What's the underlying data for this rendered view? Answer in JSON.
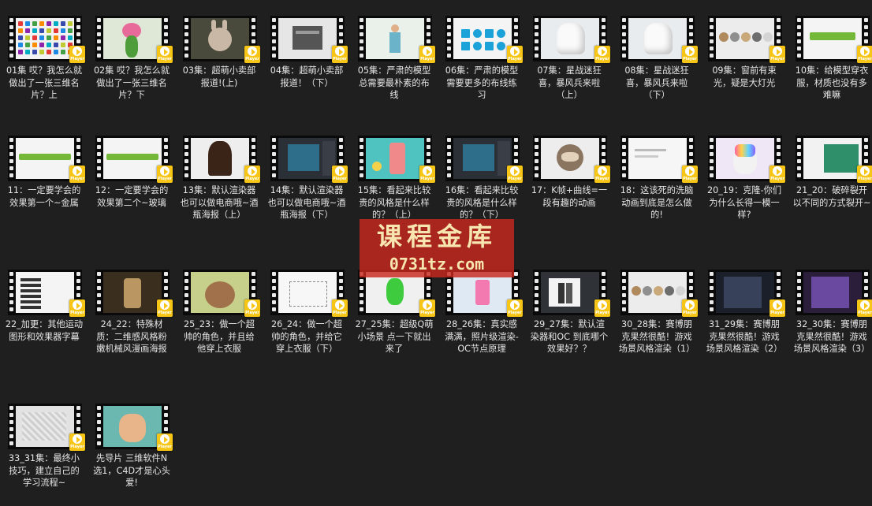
{
  "player_badge_label": "Player",
  "watermark": {
    "main": "课程金库",
    "sub": "0731tz.com"
  },
  "items": [
    {
      "title": "01集 哎？我怎么就做出了一张三维名片？上",
      "thumb": "icons-grid"
    },
    {
      "title": "02集 哎？我怎么就做出了一张三维名片？下",
      "thumb": "flower-creature"
    },
    {
      "title": "03集：超萌小卖部报道!(上)",
      "thumb": "rabbit-dark"
    },
    {
      "title": "04集：超萌小卖部报道！（下）",
      "thumb": "gray-shop"
    },
    {
      "title": "05集：严肃的模型总需要最朴素的布线",
      "thumb": "figure-light"
    },
    {
      "title": "06集：严肃的模型需要更多的布线练习",
      "thumb": "blue-shapes"
    },
    {
      "title": "07集：星战迷狂喜，暴风兵来啦（上）",
      "thumb": "white-helmet"
    },
    {
      "title": "08集：星战迷狂喜，暴风兵来啦（下）",
      "thumb": "white-helmet"
    },
    {
      "title": "09集：窗前有束光，疑是大灯光",
      "thumb": "metal-spheres"
    },
    {
      "title": "10集：给模型穿衣服，材质也没有多难嘛",
      "thumb": "material-text"
    },
    {
      "title": "11：一定要学会的效果第一个~金属",
      "thumb": "banner-metal"
    },
    {
      "title": "12：一定要学会的效果第二个~玻璃",
      "thumb": "banner-glass"
    },
    {
      "title": "13集：默认渲染器也可以做电商哦~酒瓶海报（上）",
      "thumb": "portrait-dark"
    },
    {
      "title": "14集：默认渲染器也可以做电商哦~酒瓶海报（下）",
      "thumb": "software-ui"
    },
    {
      "title": "15集：看起来比较贵的风格是什么样的？（上）",
      "thumb": "colorful-poster"
    },
    {
      "title": "16集：看起来比较贵的风格是什么样的？（下）",
      "thumb": "software-ui"
    },
    {
      "title": "17：K帧+曲线=一段有趣的动画",
      "thumb": "sloth"
    },
    {
      "title": "18：这该死的洗脑动画到底是怎么做的!",
      "thumb": "white-doc"
    },
    {
      "title": "20_19：克隆-你们为什么长得一模一样?",
      "thumb": "unicorn"
    },
    {
      "title": "21_20：破碎裂开 以不同的方式裂开~",
      "thumb": "green-map"
    },
    {
      "title": "22_加更：其他运动图形和效果器字幕",
      "thumb": "menu-list"
    },
    {
      "title": "24_22：特殊材质：二维感风格粉嫩机械风漫画海报",
      "thumb": "dark-figure"
    },
    {
      "title": "25_23：做一个超帅的角色，并且给他穿上衣服",
      "thumb": "rabbit-brown"
    },
    {
      "title": "26_24：做一个超帅的角色，并给它穿上衣服（下）",
      "thumb": "white-sketch"
    },
    {
      "title": "27_25集：超级Q萌小场景 点一下就出来了",
      "thumb": "green-cactus"
    },
    {
      "title": "28_26集：真实感满满，照片级渲染-OC节点原理",
      "thumb": "pink-scene"
    },
    {
      "title": "29_27集：默认渲染器和OC 到底哪个效果好？？",
      "thumb": "bottles-ui"
    },
    {
      "title": "30_28集：赛博朋克果然很酷！游戏场景风格渲染（1）",
      "thumb": "metal-spheres"
    },
    {
      "title": "31_29集：赛博朋克果然很酷！游戏场景风格渲染（2）",
      "thumb": "cyber-ui"
    },
    {
      "title": "32_30集：赛博朋克果然很酷！游戏场景风格渲染（3）",
      "thumb": "cyber-purple"
    },
    {
      "title": "33_31集：最终小技巧，建立自己的学习流程~",
      "thumb": "sketch-gray"
    },
    {
      "title": "先导片 三维软件N选1，C4D才是心头爱!",
      "thumb": "c4d-character"
    }
  ]
}
